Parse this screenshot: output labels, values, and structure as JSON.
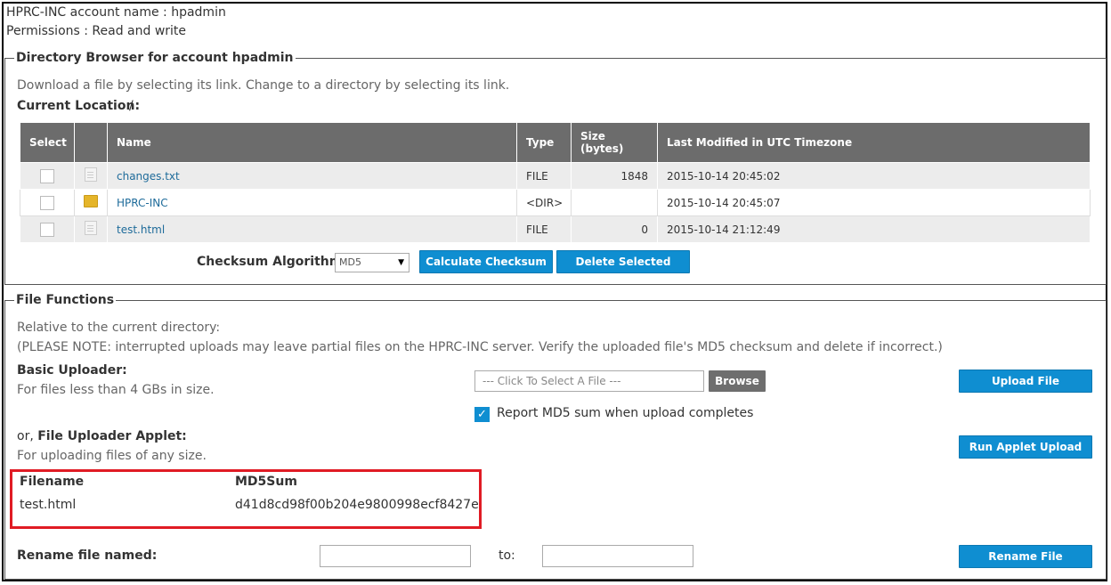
{
  "account": {
    "name_line": "HPRC-INC account name : hpadmin",
    "permissions_line": "Permissions : Read and write"
  },
  "directory_browser": {
    "legend": "Directory Browser for account hpadmin",
    "instructions": "Download a file by selecting its link. Change to a directory by selecting its link.",
    "current_location_label": "Current Location:",
    "current_location_value": "/",
    "columns": [
      "Select",
      "",
      "Name",
      "Type",
      "Size (bytes)",
      "Last Modified in UTC Timezone"
    ],
    "rows": [
      {
        "icon": "file-icon",
        "name": "changes.txt",
        "type": "FILE",
        "size": "1848",
        "modified": "2015-10-14 20:45:02"
      },
      {
        "icon": "folder-icon",
        "name": "HPRC-INC",
        "type": "<DIR>",
        "size": "",
        "modified": "2015-10-14 20:45:07"
      },
      {
        "icon": "file-icon",
        "name": "test.html",
        "type": "FILE",
        "size": "0",
        "modified": "2015-10-14 21:12:49"
      }
    ],
    "checksum_label": "Checksum Algorithm:",
    "checksum_selected": "MD5",
    "calculate_button": "Calculate Checksum",
    "delete_button": "Delete Selected"
  },
  "file_functions": {
    "legend": "File Functions",
    "relative_note": "Relative to the current directory:",
    "please_note": "(PLEASE NOTE: interrupted uploads may leave partial files on the HPRC-INC server. Verify the uploaded file's MD5 checksum and delete if incorrect.)",
    "basic_uploader_title": "Basic Uploader:",
    "basic_uploader_desc": "For files less than 4 GBs in size.",
    "file_select_placeholder": "--- Click To Select A File ---",
    "browse_button": "Browse",
    "upload_button": "Upload File",
    "report_md5_label": "Report MD5 sum when upload completes",
    "report_md5_checked": true,
    "applet_prefix": "or,",
    "applet_title": "File Uploader Applet:",
    "applet_desc": "For uploading files of any size.",
    "run_applet_button": "Run Applet Upload",
    "md5_result": {
      "filename_header": "Filename",
      "md5_header": "MD5Sum",
      "filename": "test.html",
      "md5": "d41d8cd98f00b204e9800998ecf8427e"
    },
    "rename_label": "Rename file named:",
    "rename_to_label": "to:",
    "rename_from_value": "",
    "rename_to_value": "",
    "rename_button": "Rename File"
  },
  "colors": {
    "button_blue": "#0f8ed1",
    "header_gray": "#6c6c6c",
    "highlight_red": "#e01b24",
    "link_blue": "#1e6b9a"
  }
}
